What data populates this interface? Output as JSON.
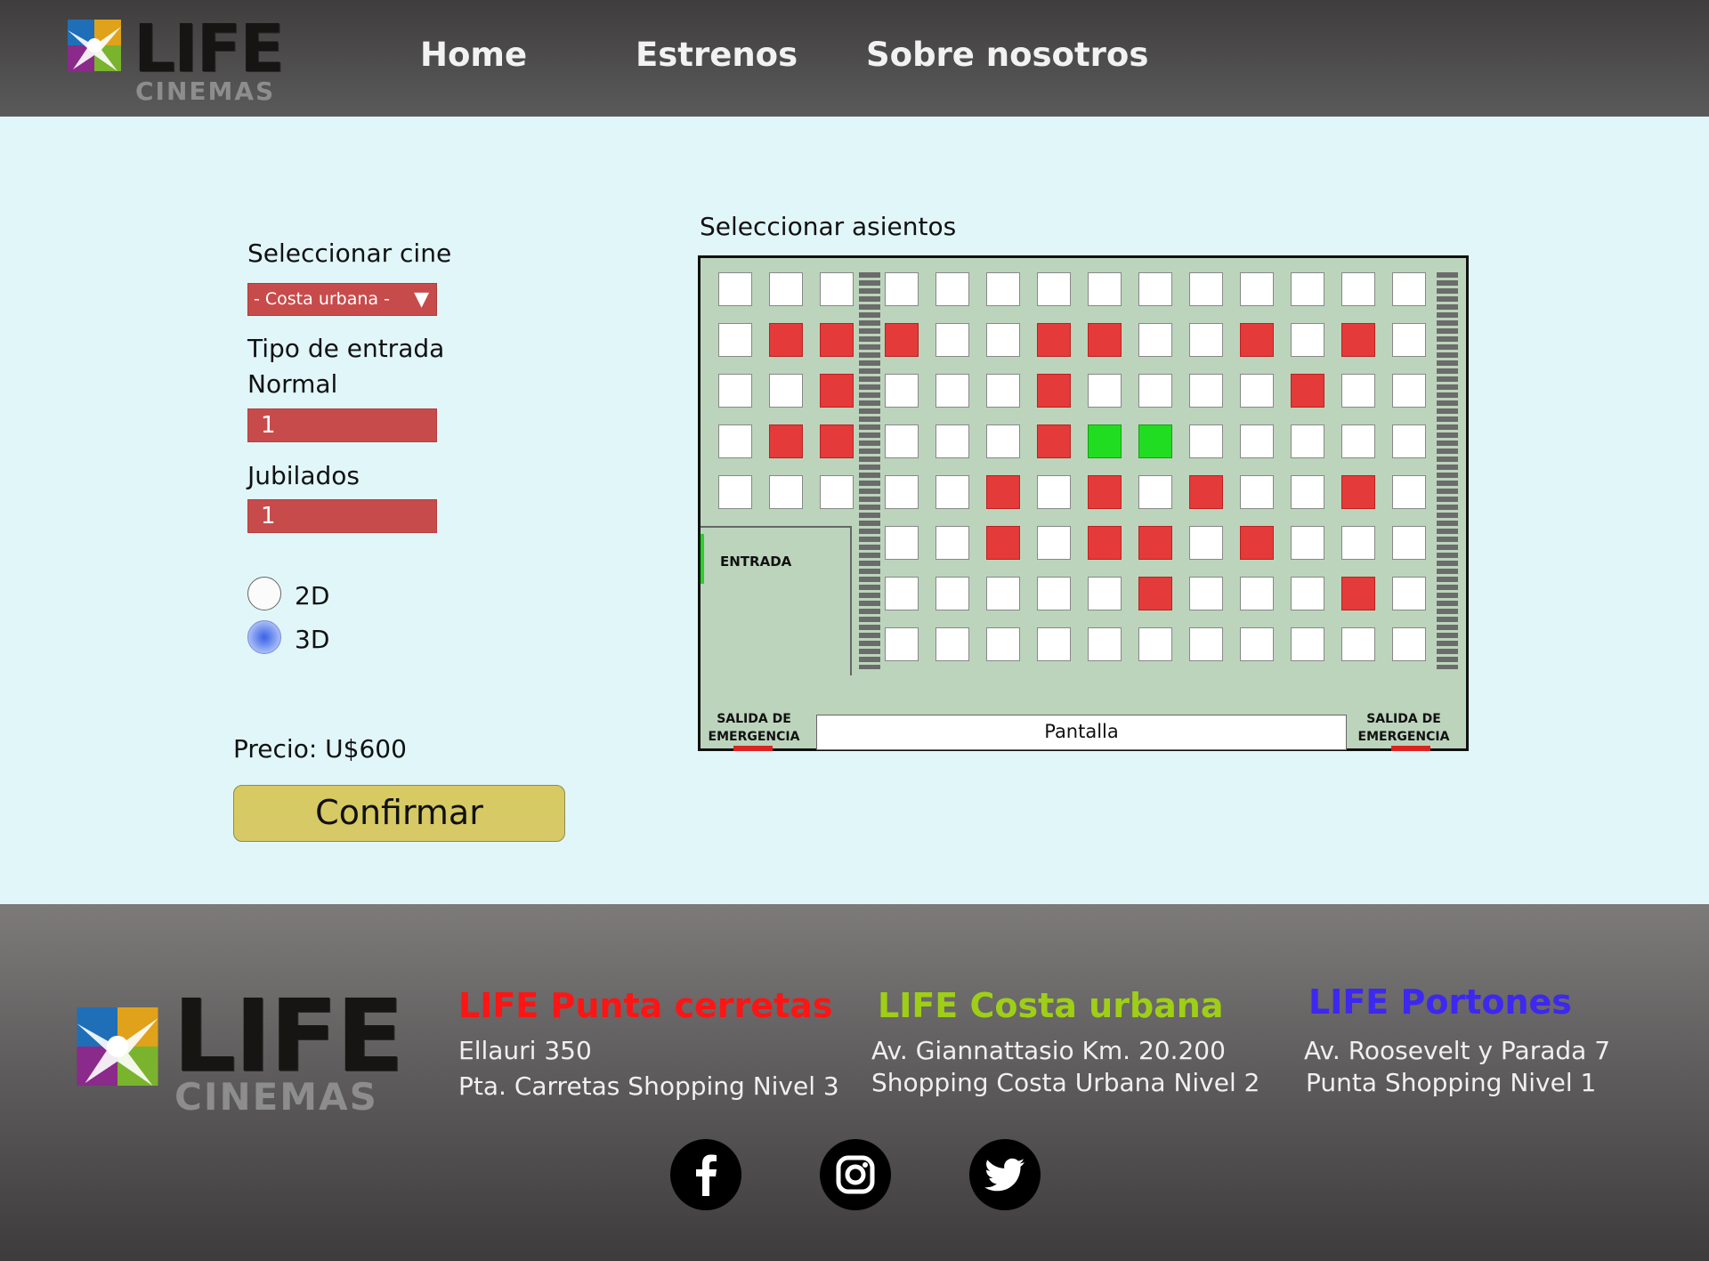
{
  "header": {
    "logo": {
      "word": "LIFE",
      "sub": "CINEMAS"
    },
    "nav": [
      {
        "label": "Home"
      },
      {
        "label": "Estrenos"
      },
      {
        "label": "Sobre nosotros"
      }
    ]
  },
  "booking": {
    "select_cinema_label": "Seleccionar cine",
    "cinema_selected": "- Costa urbana -",
    "ticket_type_label": "Tipo de entrada",
    "normal_label": "Normal",
    "normal_qty": "1",
    "jubilados_label": "Jubilados",
    "jubilados_qty": "1",
    "format_options": [
      {
        "label": "2D",
        "checked": false
      },
      {
        "label": "3D",
        "checked": true
      }
    ],
    "price_text": "Precio: U$600",
    "confirm_label": "Confirmar"
  },
  "seatmap": {
    "title": "Seleccionar asientos",
    "entrance_label": "ENTRADA",
    "screen_label": "Pantalla",
    "emergency_exit_label": [
      "SALIDA DE",
      "EMERGENCIA"
    ],
    "legend_colors": {
      "free": "#ffffff",
      "occupied": "#e43a3a",
      "selected": "#21dd21"
    },
    "rows": [
      "...|..............",
      ".XX|X..XX..X.X.",
      "..X|...X....X..",
      ".XX|...XSS.....",
      "...|..X.X.X..X.",
      "|..X.XX.X...",
      "|.....X...X..",
      "|............."
    ]
  },
  "footer": {
    "logo": {
      "word": "LIFE",
      "sub": "CINEMAS"
    },
    "locations": [
      {
        "name": "LIFE Punta cerretas",
        "line1": "Ellauri 350",
        "line2": "Pta. Carretas Shopping Nivel 3",
        "color": "#ff1414"
      },
      {
        "name": "LIFE Costa urbana",
        "line1": "Av. Giannattasio Km. 20.200",
        "line2": "Shopping Costa Urbana Nivel 2",
        "color": "#9ecf16"
      },
      {
        "name": "LIFE Portones",
        "line1": "Av. Roosevelt y Parada 7",
        "line2": "Punta Shopping Nivel 1",
        "color": "#3c28ef"
      }
    ],
    "social": [
      "facebook-icon",
      "instagram-icon",
      "twitter-icon"
    ]
  }
}
